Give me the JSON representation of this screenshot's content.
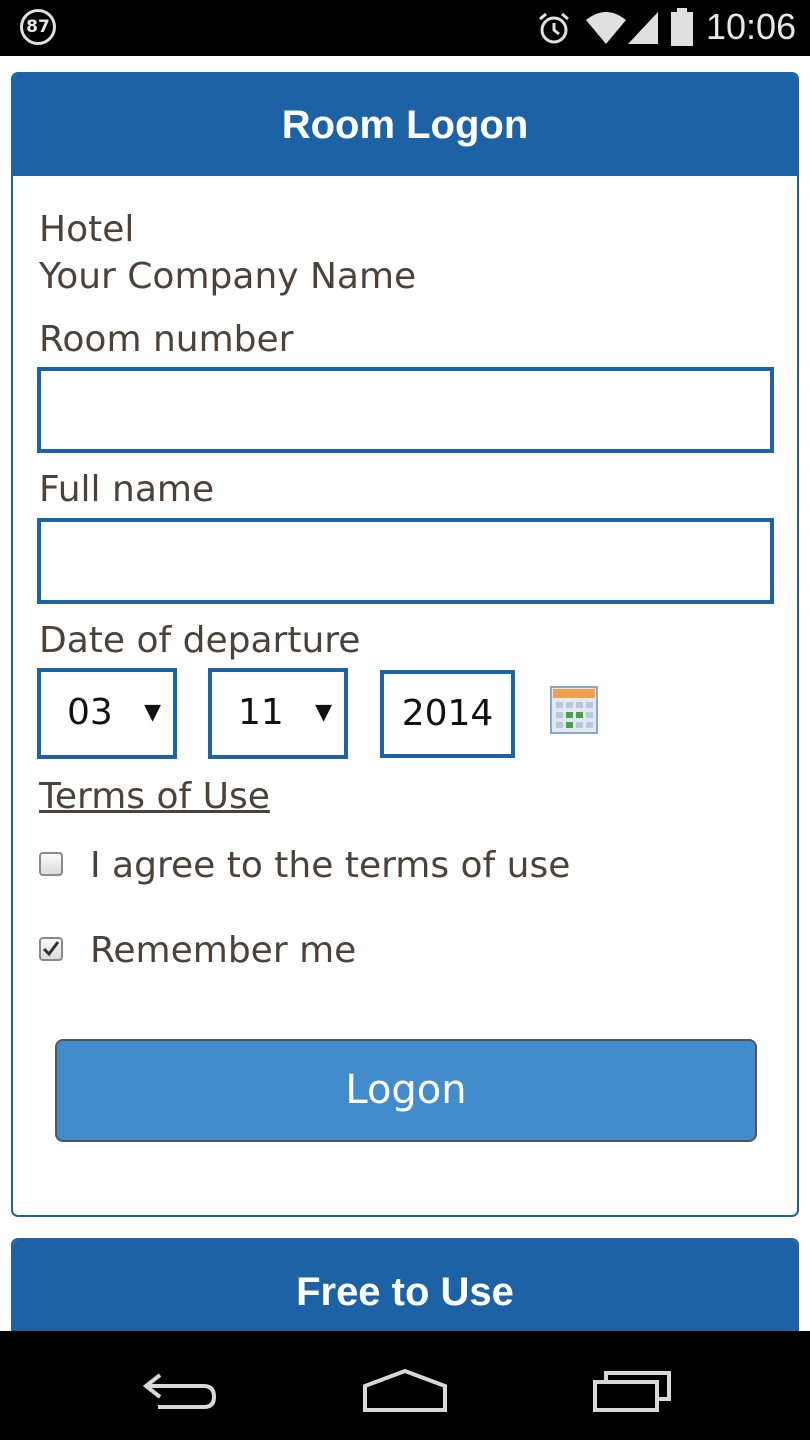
{
  "status_bar": {
    "notification_count": "87",
    "time": "10:06",
    "icons": [
      "alarm-icon",
      "wifi-icon",
      "signal-icon",
      "battery-icon"
    ]
  },
  "form": {
    "title": "Room Logon",
    "hotel_label": "Hotel",
    "company_name": "Your Company Name",
    "room_number_label": "Room number",
    "room_number_value": "",
    "full_name_label": "Full name",
    "full_name_value": "",
    "departure_label": "Date of departure",
    "departure_day": "03",
    "departure_month": "11",
    "departure_year": "2014",
    "terms_link": "Terms of Use",
    "agree_label": "I agree to the terms of use",
    "agree_checked": false,
    "remember_label": "Remember me",
    "remember_checked": true,
    "logon_button": "Logon"
  },
  "second_panel": {
    "title": "Free to Use"
  },
  "colors": {
    "primary": "#1c62a5",
    "button": "#438ccc",
    "text": "#4d4239"
  }
}
